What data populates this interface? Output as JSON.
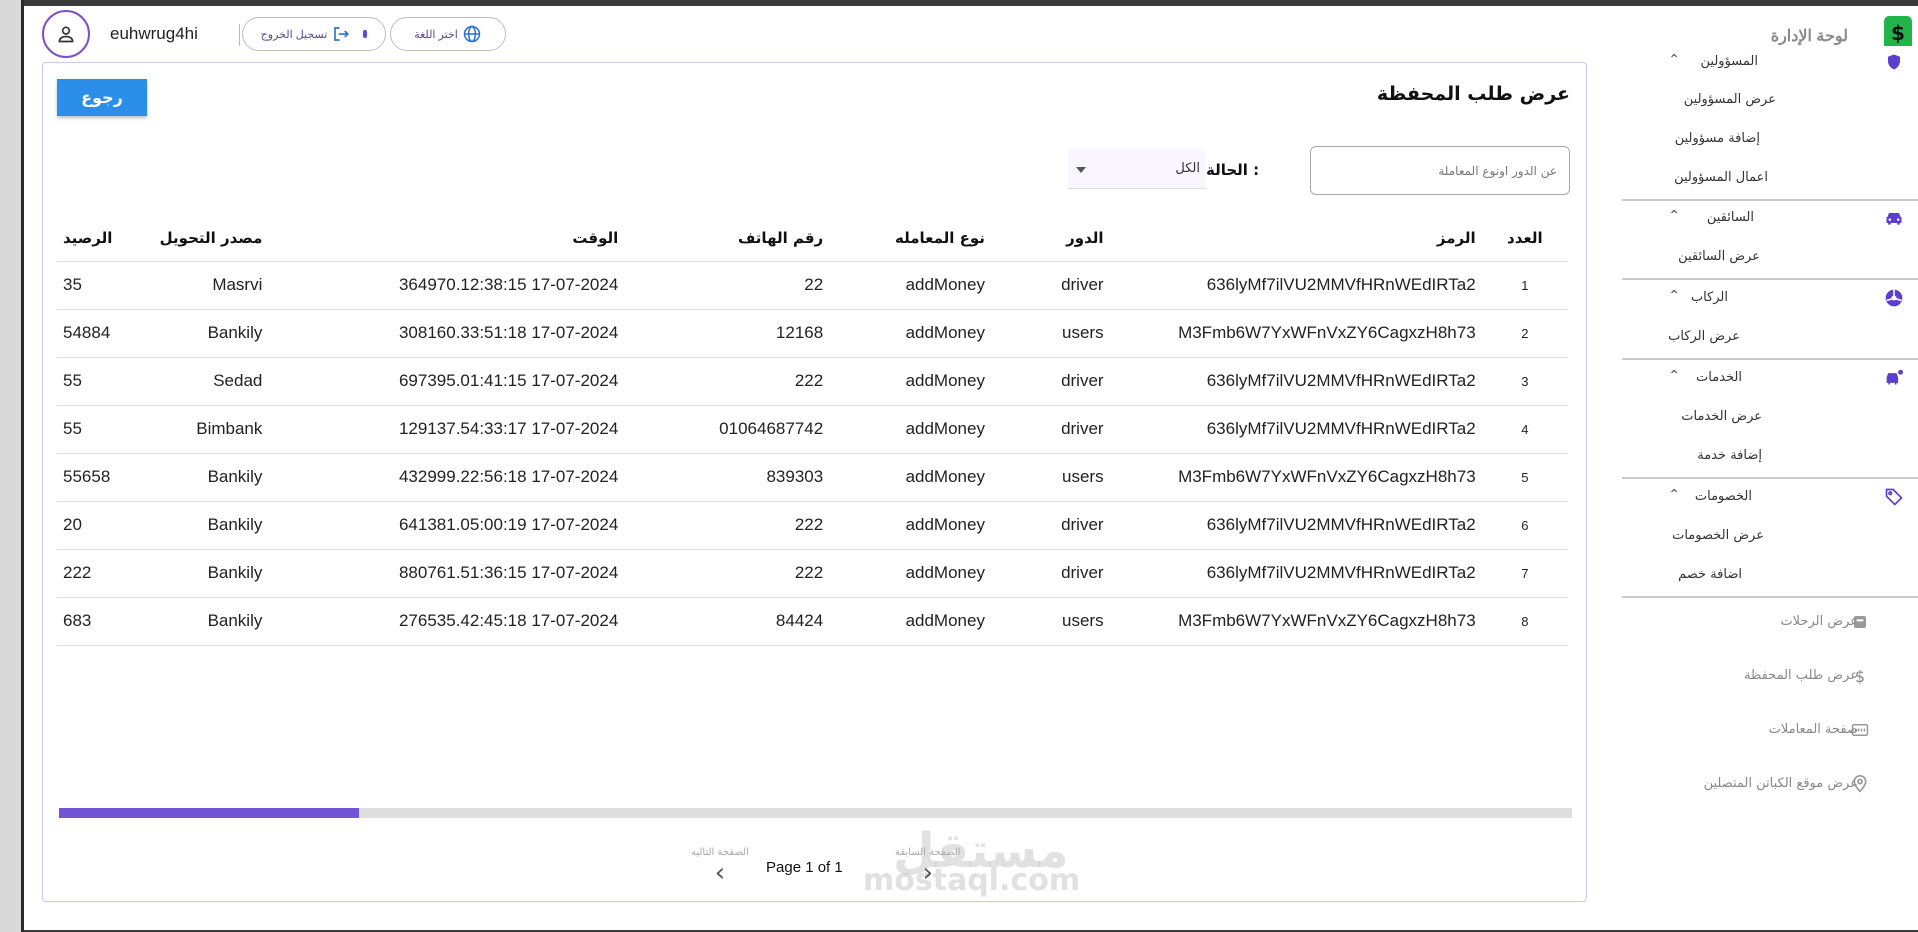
{
  "brand": {
    "title": "لوحة الإدارة",
    "logo_glyph": "$"
  },
  "header": {
    "username": "euhwrug4hi",
    "logout_label": "تسجيل الخروج",
    "language_label": "اختر اللغة"
  },
  "page": {
    "title": "عرض طلب المحفظة",
    "back_label": "رجوع",
    "search_placeholder": "عن الدور اونوع المعاملة",
    "status_label": "الحالة :",
    "status_value": "الكل"
  },
  "table": {
    "headers": {
      "num": "العدد",
      "code": "الرمز",
      "role": "الدور",
      "type": "نوع المعامله",
      "phone": "رقم الهاتف",
      "time": "الوقت",
      "source": "مصدر التحويل",
      "balance": "الرصيد"
    },
    "rows": [
      {
        "num": "1",
        "code": "636lyMf7ilVU2MMVfHRnWEdIRTa2",
        "role": "driver",
        "type": "addMoney",
        "phone": "22",
        "time": "364970.12:38:15 17-07-2024",
        "source": "Masrvi",
        "balance": "35"
      },
      {
        "num": "2",
        "code": "M3Fmb6W7YxWFnVxZY6CagxzH8h73",
        "role": "users",
        "type": "addMoney",
        "phone": "12168",
        "time": "308160.33:51:18 17-07-2024",
        "source": "Bankily",
        "balance": "54884"
      },
      {
        "num": "3",
        "code": "636lyMf7ilVU2MMVfHRnWEdIRTa2",
        "role": "driver",
        "type": "addMoney",
        "phone": "222",
        "time": "697395.01:41:15 17-07-2024",
        "source": "Sedad",
        "balance": "55"
      },
      {
        "num": "4",
        "code": "636lyMf7ilVU2MMVfHRnWEdIRTa2",
        "role": "driver",
        "type": "addMoney",
        "phone": "01064687742",
        "time": "129137.54:33:17 17-07-2024",
        "source": "Bimbank",
        "balance": "55"
      },
      {
        "num": "5",
        "code": "M3Fmb6W7YxWFnVxZY6CagxzH8h73",
        "role": "users",
        "type": "addMoney",
        "phone": "839303",
        "time": "432999.22:56:18 17-07-2024",
        "source": "Bankily",
        "balance": "55658"
      },
      {
        "num": "6",
        "code": "636lyMf7ilVU2MMVfHRnWEdIRTa2",
        "role": "driver",
        "type": "addMoney",
        "phone": "222",
        "time": "641381.05:00:19 17-07-2024",
        "source": "Bankily",
        "balance": "20"
      },
      {
        "num": "7",
        "code": "636lyMf7ilVU2MMVfHRnWEdIRTa2",
        "role": "driver",
        "type": "addMoney",
        "phone": "222",
        "time": "880761.51:36:15 17-07-2024",
        "source": "Bankily",
        "balance": "222"
      },
      {
        "num": "8",
        "code": "M3Fmb6W7YxWFnVxZY6CagxzH8h73",
        "role": "users",
        "type": "addMoney",
        "phone": "84424",
        "time": "276535.42:45:18 17-07-2024",
        "source": "Bankily",
        "balance": "683"
      }
    ]
  },
  "pagination": {
    "info": "Page 1 of 1",
    "next_label": "الصفحة التاليه",
    "prev_label": "الصفحة السابقة"
  },
  "sidebar": {
    "sections": [
      {
        "title": "المسؤولين",
        "icon": "admin-shield-icon",
        "items": [
          "عرض المسؤولين",
          "إضافة مسؤولين",
          "اعمال المسؤولين"
        ]
      },
      {
        "title": "السائقين",
        "icon": "car-icon",
        "items": [
          "عرض السائقين"
        ]
      },
      {
        "title": "الركاب",
        "icon": "passenger-icon",
        "items": [
          "عرض الركاب"
        ]
      },
      {
        "title": "الخدمات",
        "icon": "services-icon",
        "items": [
          "عرض الخدمات",
          "إضافة خدمة"
        ]
      },
      {
        "title": "الخصومات",
        "icon": "tag-icon",
        "items": [
          "عرض الخصومات",
          "اضافة خصم"
        ]
      }
    ],
    "links": [
      {
        "label": "عرض الرحلات",
        "icon": "trips-icon"
      },
      {
        "label": "عرض طلب المحفظة",
        "icon": "dollar-icon"
      },
      {
        "label": "صفحة المعاملات",
        "icon": "transactions-icon"
      },
      {
        "label": "عرض موقع الكباتن المتصلين",
        "icon": "location-pin-icon"
      }
    ]
  },
  "watermark": {
    "text": "mostaql.com",
    "arabic": "مستقل"
  },
  "colors": {
    "accent": "#7353d6",
    "button": "#2b8fe9",
    "brand_green": "#20b44a"
  }
}
